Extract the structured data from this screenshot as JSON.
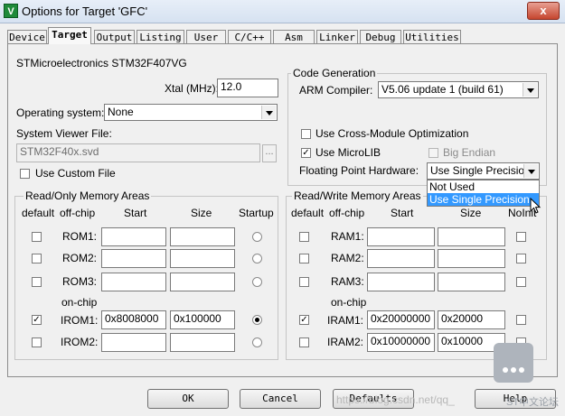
{
  "window": {
    "title": "Options for Target 'GFC'",
    "icon": "V",
    "close": "x"
  },
  "tabs": [
    "Device",
    "Target",
    "Output",
    "Listing",
    "User",
    "C/C++",
    "Asm",
    "Linker",
    "Debug",
    "Utilities"
  ],
  "device_name": "STMicroelectronics STM32F407VG",
  "xtal": {
    "label": "Xtal (MHz):",
    "value": "12.0"
  },
  "os": {
    "label": "Operating system:",
    "value": "None"
  },
  "svf": {
    "label": "System Viewer File:",
    "value": "STM32F40x.svd",
    "browse": "..."
  },
  "use_custom_file": {
    "label": "Use Custom File"
  },
  "code_gen": {
    "title": "Code Generation",
    "arm_compiler_label": "ARM Compiler:",
    "arm_compiler_value": "V5.06 update 1 (build 61)",
    "cross_module": "Use Cross-Module Optimization",
    "microlib": "Use MicroLIB",
    "big_endian": "Big Endian",
    "fph_label": "Floating Point Hardware:",
    "fph_value": "Use Single Precision",
    "fph_options": [
      "Not Used",
      "Use Single Precision"
    ]
  },
  "ro_mem": {
    "title": "Read/Only Memory Areas",
    "headers": {
      "default": "default",
      "offchip": "off-chip",
      "start": "Start",
      "size": "Size",
      "startup": "Startup"
    },
    "onchip_label": "on-chip",
    "rows": [
      {
        "name": "ROM1:",
        "start": "",
        "size": ""
      },
      {
        "name": "ROM2:",
        "start": "",
        "size": ""
      },
      {
        "name": "ROM3:",
        "start": "",
        "size": ""
      },
      {
        "name": "IROM1:",
        "start": "0x8008000",
        "size": "0x100000"
      },
      {
        "name": "IROM2:",
        "start": "",
        "size": ""
      }
    ]
  },
  "rw_mem": {
    "title": "Read/Write Memory Areas",
    "headers": {
      "default": "default",
      "offchip": "off-chip",
      "start": "Start",
      "size": "Size",
      "noinit": "NoInit"
    },
    "onchip_label": "on-chip",
    "rows": [
      {
        "name": "RAM1:",
        "start": "",
        "size": ""
      },
      {
        "name": "RAM2:",
        "start": "",
        "size": ""
      },
      {
        "name": "RAM3:",
        "start": "",
        "size": ""
      },
      {
        "name": "IRAM1:",
        "start": "0x20000000",
        "size": "0x20000"
      },
      {
        "name": "IRAM2:",
        "start": "0x10000000",
        "size": "0x10000"
      }
    ]
  },
  "buttons": {
    "ok": "OK",
    "cancel": "Cancel",
    "defaults": "Defaults",
    "help": "Help"
  },
  "watermark": "https://blog.csdn.net/qq_",
  "corner_watermark": "ST中文论坛",
  "check_mark": "✓"
}
